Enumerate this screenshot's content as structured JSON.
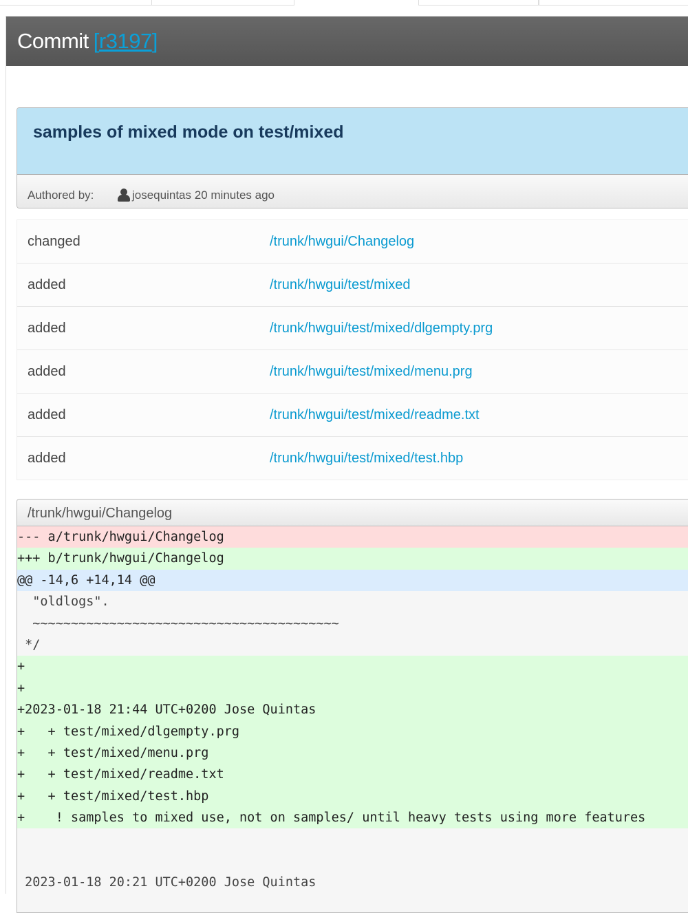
{
  "header": {
    "title": "Commit",
    "revision": "r3197"
  },
  "summary": {
    "message": "samples of mixed mode on test/mixed",
    "authored_label": "Authored by:",
    "author": "josequintas",
    "time": "20 minutes ago"
  },
  "changes": [
    {
      "action": "changed",
      "path": "/trunk/hwgui/Changelog"
    },
    {
      "action": "added",
      "path": "/trunk/hwgui/test/mixed"
    },
    {
      "action": "added",
      "path": "/trunk/hwgui/test/mixed/dlgempty.prg"
    },
    {
      "action": "added",
      "path": "/trunk/hwgui/test/mixed/menu.prg"
    },
    {
      "action": "added",
      "path": "/trunk/hwgui/test/mixed/readme.txt"
    },
    {
      "action": "added",
      "path": "/trunk/hwgui/test/mixed/test.hbp"
    }
  ],
  "diff": {
    "file": "/trunk/hwgui/Changelog",
    "lines": [
      {
        "type": "del",
        "text": "--- a/trunk/hwgui/Changelog"
      },
      {
        "type": "add",
        "text": "+++ b/trunk/hwgui/Changelog"
      },
      {
        "type": "hunk",
        "text": "@@ -14,6 +14,14 @@"
      },
      {
        "type": "ctx",
        "text": "  \"oldlogs\"."
      },
      {
        "type": "ctx",
        "text": "  ~~~~~~~~~~~~~~~~~~~~~~~~~~~~~~~~~~~~~~~~"
      },
      {
        "type": "ctx",
        "text": " */"
      },
      {
        "type": "add",
        "text": "+"
      },
      {
        "type": "add",
        "text": "+"
      },
      {
        "type": "add",
        "text": "+2023-01-18 21:44 UTC+0200 Jose Quintas"
      },
      {
        "type": "add",
        "text": "+   + test/mixed/dlgempty.prg"
      },
      {
        "type": "add",
        "text": "+   + test/mixed/menu.prg"
      },
      {
        "type": "add",
        "text": "+   + test/mixed/readme.txt"
      },
      {
        "type": "add",
        "text": "+   + test/mixed/test.hbp"
      },
      {
        "type": "add",
        "text": "+    ! samples to mixed use, not on samples/ until heavy tests using more features"
      },
      {
        "type": "ctx",
        "text": ""
      },
      {
        "type": "ctx",
        "text": ""
      },
      {
        "type": "ctx",
        "text": " 2023-01-18 20:21 UTC+0200 Jose Quintas"
      }
    ]
  }
}
